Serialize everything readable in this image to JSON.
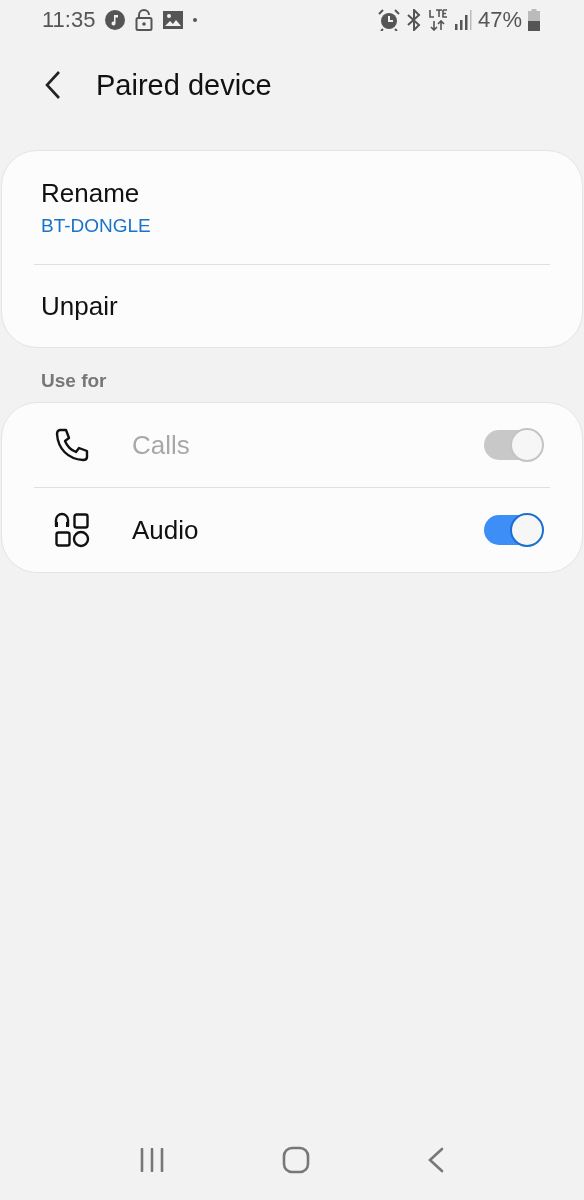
{
  "status_bar": {
    "time": "11:35",
    "battery": "47%"
  },
  "header": {
    "title": "Paired device"
  },
  "device_card": {
    "items": [
      {
        "label": "Rename",
        "value": "BT-DONGLE"
      },
      {
        "label": "Unpair"
      }
    ]
  },
  "use_for": {
    "heading": "Use for",
    "items": [
      {
        "kind": "phone",
        "label": "Calls",
        "on": true,
        "disabled": true
      },
      {
        "kind": "audio",
        "label": "Audio",
        "on": true,
        "disabled": false
      }
    ]
  }
}
